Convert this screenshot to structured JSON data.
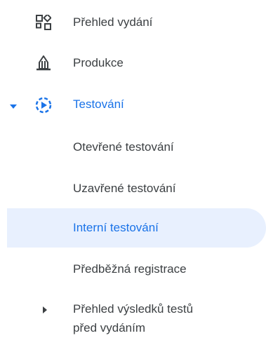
{
  "nav": {
    "items": [
      {
        "label": "Přehled vydání",
        "icon": "dashboard-icon"
      },
      {
        "label": "Produkce",
        "icon": "production-icon"
      },
      {
        "label": "Testování",
        "icon": "testing-icon",
        "expanded": true
      },
      {
        "label": "Otevřené testování"
      },
      {
        "label": "Uzavřené testování"
      },
      {
        "label": "Interní testování",
        "selected": true
      },
      {
        "label": "Předběžná registrace"
      },
      {
        "label_line1": "Přehled výsledků testů",
        "label_line2": "před vydáním",
        "collapsed": true
      }
    ]
  },
  "colors": {
    "accent": "#1a73e8",
    "selected_bg": "#e8f0fe",
    "text": "#3c4043"
  }
}
